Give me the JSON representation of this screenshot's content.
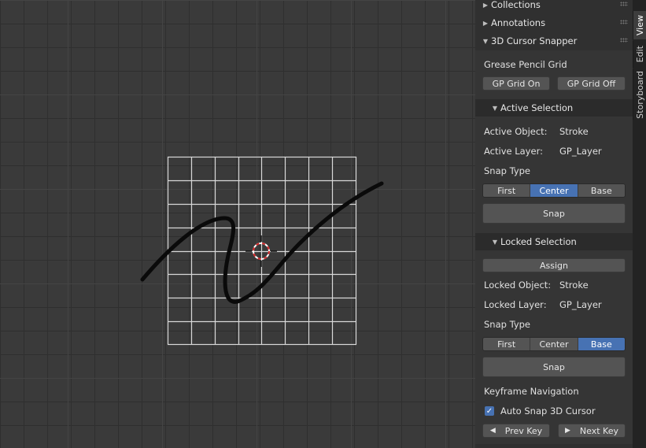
{
  "tabs": [
    "View",
    "Edit",
    "Storyboard"
  ],
  "panels": {
    "collections": "Collections",
    "annotations": "Annotations",
    "cursor_snapper": "3D Cursor Snapper"
  },
  "gp_grid": {
    "label": "Grease Pencil Grid",
    "on": "GP Grid On",
    "off": "GP Grid Off"
  },
  "active": {
    "title": "Active Selection",
    "object_label": "Active Object:",
    "object_value": "Stroke",
    "layer_label": "Active Layer:",
    "layer_value": "GP_Layer",
    "snap_type_label": "Snap Type",
    "snap_options": [
      "First",
      "Center",
      "Base"
    ],
    "snap_selected": "Center",
    "snap_button": "Snap"
  },
  "locked": {
    "title": "Locked Selection",
    "assign": "Assign",
    "object_label": "Locked Object:",
    "object_value": "Stroke",
    "layer_label": "Locked Layer:",
    "layer_value": "GP_Layer",
    "snap_type_label": "Snap Type",
    "snap_options": [
      "First",
      "Center",
      "Base"
    ],
    "snap_selected": "Base",
    "snap_button": "Snap"
  },
  "keyframe": {
    "label": "Keyframe Navigation",
    "auto_snap_label": "Auto Snap 3D Cursor",
    "auto_snap_checked": true,
    "prev": "Prev Key",
    "next": "Next Key"
  },
  "colors": {
    "accent": "#4772b3",
    "viewport_bg": "#3a3a3a",
    "panel_bg": "#303030"
  }
}
